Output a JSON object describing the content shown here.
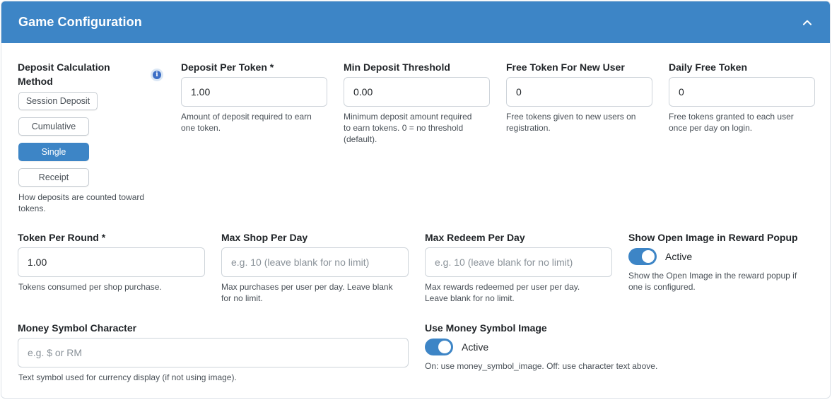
{
  "header": {
    "title": "Game Configuration",
    "collapse_icon": "chevron-up-icon"
  },
  "deposit_method": {
    "label_line1": "Deposit Calculation",
    "label_line2": "Method",
    "info_icon": "info-icon",
    "info_glyph": "i",
    "options": [
      "Session Deposit",
      "Cumulative",
      "Single",
      "Receipt"
    ],
    "selected": "Single",
    "help_line1": "How deposits are counted toward",
    "help_line2": "tokens."
  },
  "deposit_per_token": {
    "label": "Deposit Per Token *",
    "value": "1.00",
    "help_line1": "Amount of deposit required to earn",
    "help_line2": "one token."
  },
  "min_deposit_threshold": {
    "label": "Min Deposit Threshold",
    "value": "0.00",
    "help_line1": "Minimum deposit amount required",
    "help_line2": "to earn tokens. 0 = no threshold",
    "help_line3": "(default)."
  },
  "free_token_new_user": {
    "label": "Free Token For New User",
    "value": "0",
    "help_line1": "Free tokens given to new users on",
    "help_line2": "registration."
  },
  "daily_free_token": {
    "label": "Daily Free Token",
    "value": "0",
    "help_line1": "Free tokens granted to each user",
    "help_line2": "once per day on login."
  },
  "token_per_round": {
    "label": "Token Per Round *",
    "value": "1.00",
    "help": "Tokens consumed per shop purchase."
  },
  "max_shop_per_day": {
    "label": "Max Shop Per Day",
    "value": "",
    "placeholder": "e.g. 10 (leave blank for no limit)",
    "help_line1": "Max purchases per user per day. Leave blank",
    "help_line2": "for no limit."
  },
  "max_redeem_per_day": {
    "label": "Max Redeem Per Day",
    "value": "",
    "placeholder": "e.g. 10 (leave blank for no limit)",
    "help_line1": "Max rewards redeemed per user per day.",
    "help_line2": "Leave blank for no limit."
  },
  "show_open_image": {
    "label": "Show Open Image in Reward Popup",
    "state": "Active",
    "enabled": true,
    "help_line1": "Show the Open Image in the reward popup if",
    "help_line2": "one is configured."
  },
  "money_symbol_character": {
    "label": "Money Symbol Character",
    "value": "",
    "placeholder": "e.g. $ or RM",
    "help": "Text symbol used for currency display (if not using image)."
  },
  "use_money_symbol_image": {
    "label": "Use Money Symbol Image",
    "state": "Active",
    "enabled": true,
    "help": "On: use money_symbol_image. Off: use character text above."
  },
  "colors": {
    "primary": "#3d85c6",
    "border": "#ced4da",
    "help_text": "#495057"
  }
}
